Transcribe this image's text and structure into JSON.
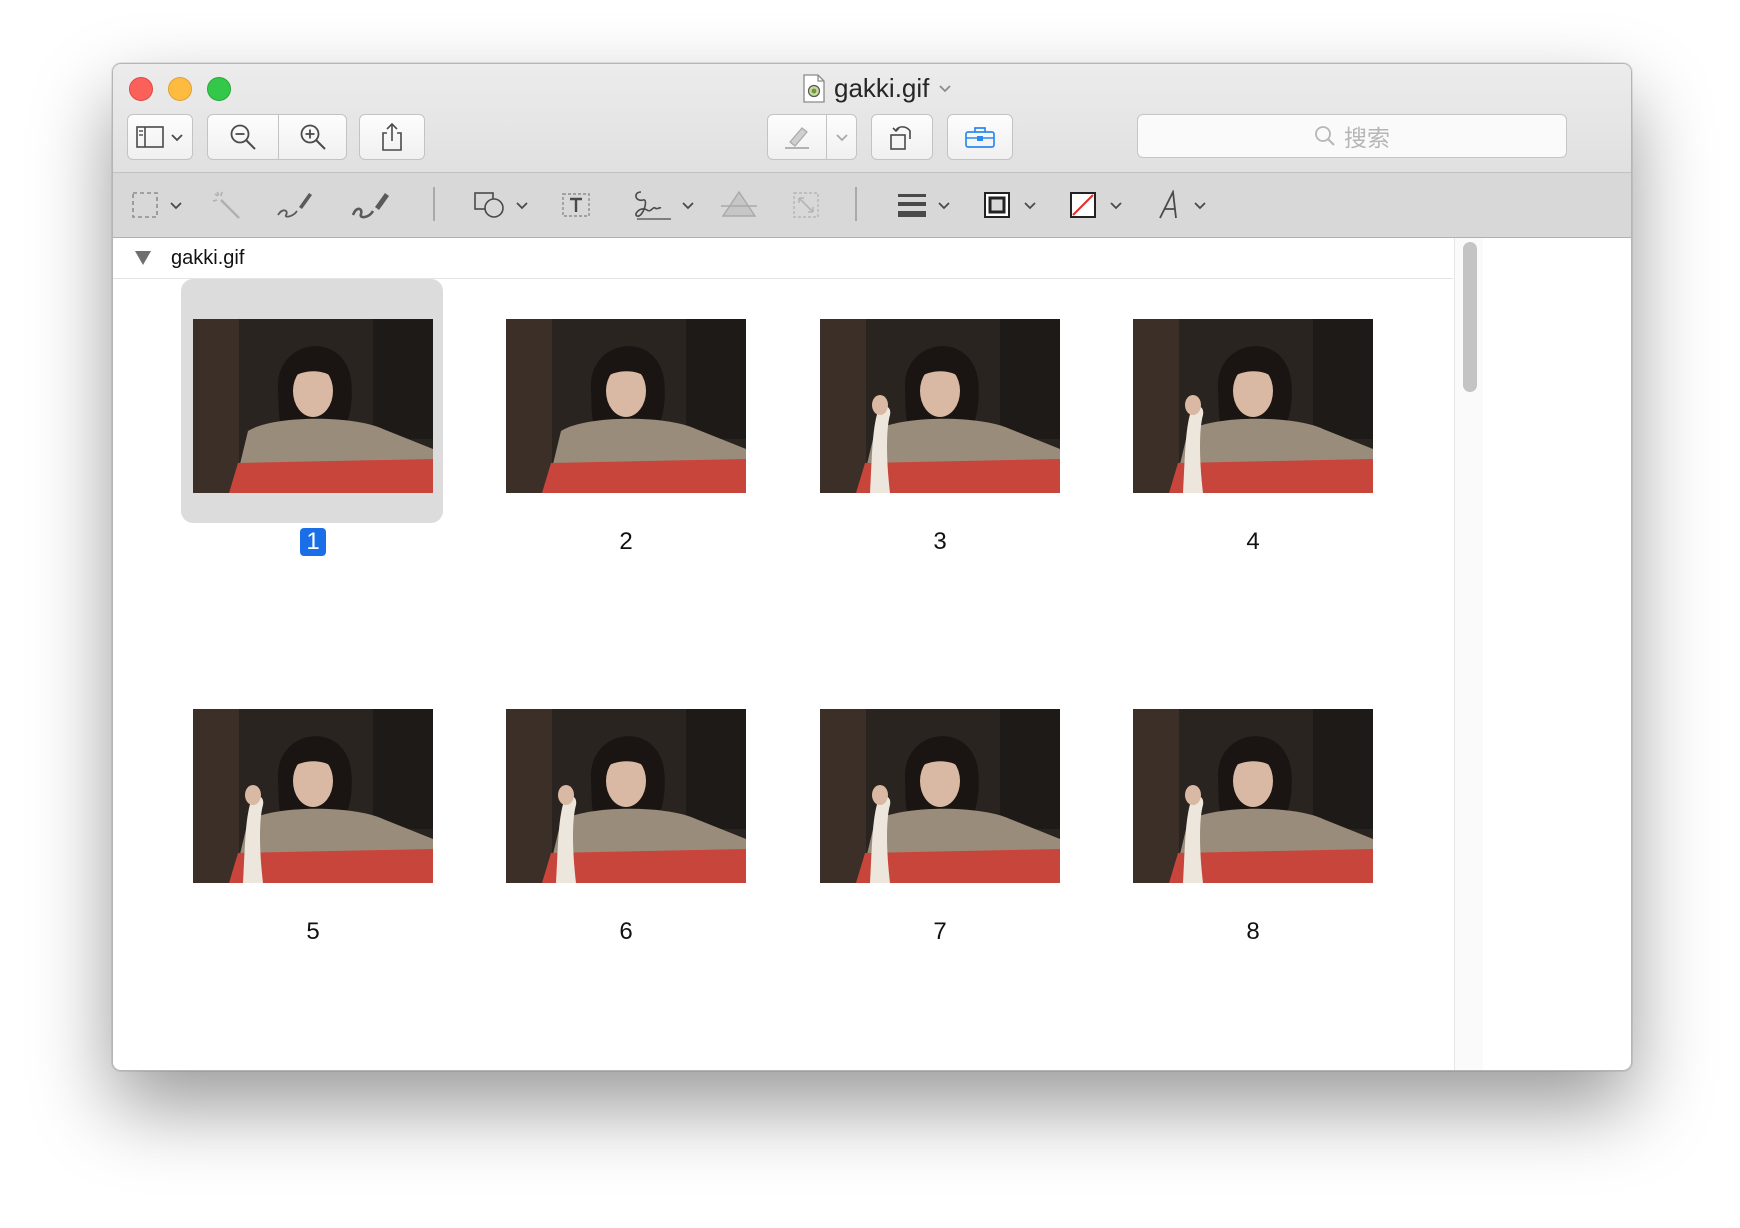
{
  "window": {
    "title": "gakki.gif",
    "file_icon": "preview-document-icon"
  },
  "toolbar": {
    "buttons": [
      {
        "name": "sidebar-toggle-button",
        "icon": "sidebar-icon"
      },
      {
        "name": "zoom-out-button",
        "icon": "zoom-out-icon"
      },
      {
        "name": "zoom-in-button",
        "icon": "zoom-in-icon"
      },
      {
        "name": "share-button",
        "icon": "share-icon"
      },
      {
        "name": "highlight-button",
        "icon": "highlighter-icon"
      },
      {
        "name": "rotate-button",
        "icon": "rotate-icon"
      },
      {
        "name": "markup-toolbox-button",
        "icon": "toolbox-icon"
      }
    ],
    "search": {
      "placeholder": "搜索"
    },
    "accent_color": "#2d89f0"
  },
  "markup_toolbar": {
    "tools": [
      "rectangular-selection-icon",
      "instant-alpha-icon",
      "sketch-icon",
      "draw-icon",
      "shapes-icon",
      "text-icon",
      "sign-icon",
      "adjust-color-icon",
      "adjust-size-icon",
      "shape-style-icon",
      "border-color-icon",
      "fill-color-icon",
      "text-style-icon"
    ]
  },
  "sidebar": {
    "document_name": "gakki.gif",
    "expanded": true
  },
  "frames": [
    {
      "label": "1",
      "selected": true
    },
    {
      "label": "2",
      "selected": false
    },
    {
      "label": "3",
      "selected": false
    },
    {
      "label": "4",
      "selected": false
    },
    {
      "label": "5",
      "selected": false
    },
    {
      "label": "6",
      "selected": false
    },
    {
      "label": "7",
      "selected": false
    },
    {
      "label": "8",
      "selected": false
    }
  ],
  "colors": {
    "selection_badge": "#1a6ee8",
    "selected_cell": "#dcdcdc",
    "close": "#fc605b",
    "minimize": "#fdbc40",
    "zoom": "#34c84a"
  }
}
